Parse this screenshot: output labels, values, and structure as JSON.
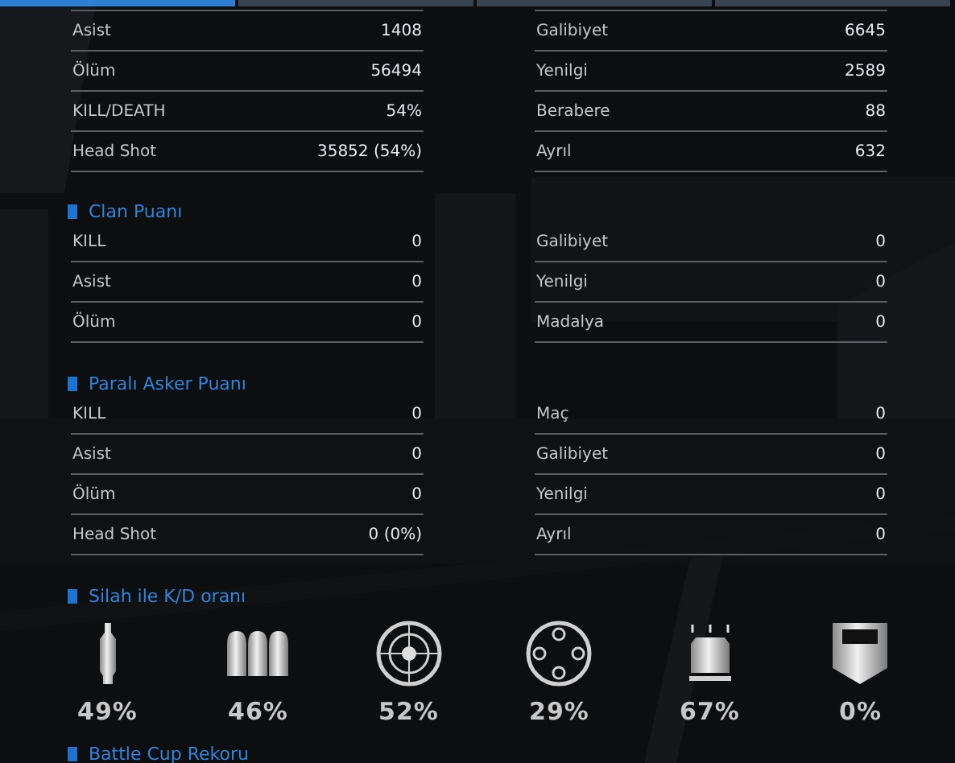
{
  "tabs": [
    {
      "selected": true
    },
    {
      "selected": false
    },
    {
      "selected": false
    },
    {
      "selected": false
    }
  ],
  "sections": [
    {
      "left": [
        {
          "label": "Asist",
          "value": "1408"
        },
        {
          "label": "Ölüm",
          "value": "56494"
        },
        {
          "label": "KILL/DEATH",
          "value": "54%"
        },
        {
          "label": "Head Shot",
          "value": "35852 (54%)"
        }
      ],
      "right": [
        {
          "label": "Galibiyet",
          "value": "6645"
        },
        {
          "label": "Yenilgi",
          "value": "2589"
        },
        {
          "label": "Berabere",
          "value": "88"
        },
        {
          "label": "Ayrıl",
          "value": "632"
        }
      ]
    },
    {
      "heading": "Clan Puanı",
      "left": [
        {
          "label": "KILL",
          "value": "0"
        },
        {
          "label": "Asist",
          "value": "0"
        },
        {
          "label": "Ölüm",
          "value": "0"
        }
      ],
      "right": [
        {
          "label": "Galibiyet",
          "value": "0"
        },
        {
          "label": "Yenilgi",
          "value": "0"
        },
        {
          "label": "Madalya",
          "value": "0"
        }
      ]
    },
    {
      "heading": "Paralı Asker Puanı",
      "left": [
        {
          "label": "KILL",
          "value": "0"
        },
        {
          "label": "Asist",
          "value": "0"
        },
        {
          "label": "Ölüm",
          "value": "0"
        },
        {
          "label": "Head Shot",
          "value": "0 (0%)"
        }
      ],
      "right": [
        {
          "label": "Maç",
          "value": "0"
        },
        {
          "label": "Galibiyet",
          "value": "0"
        },
        {
          "label": "Yenilgi",
          "value": "0"
        },
        {
          "label": "Ayrıl",
          "value": "0"
        }
      ]
    }
  ],
  "weapon_kd": {
    "heading": "Silah ile K/D oranı",
    "items": [
      {
        "kind": "bullet",
        "value": "49%"
      },
      {
        "kind": "bullets",
        "value": "46%"
      },
      {
        "kind": "crosshair",
        "value": "52%"
      },
      {
        "kind": "dotted-circle",
        "value": "29%"
      },
      {
        "kind": "box",
        "value": "67%"
      },
      {
        "kind": "shield",
        "value": "0%"
      }
    ]
  },
  "battle_cup": {
    "heading": "Battle Cup Rekoru"
  }
}
